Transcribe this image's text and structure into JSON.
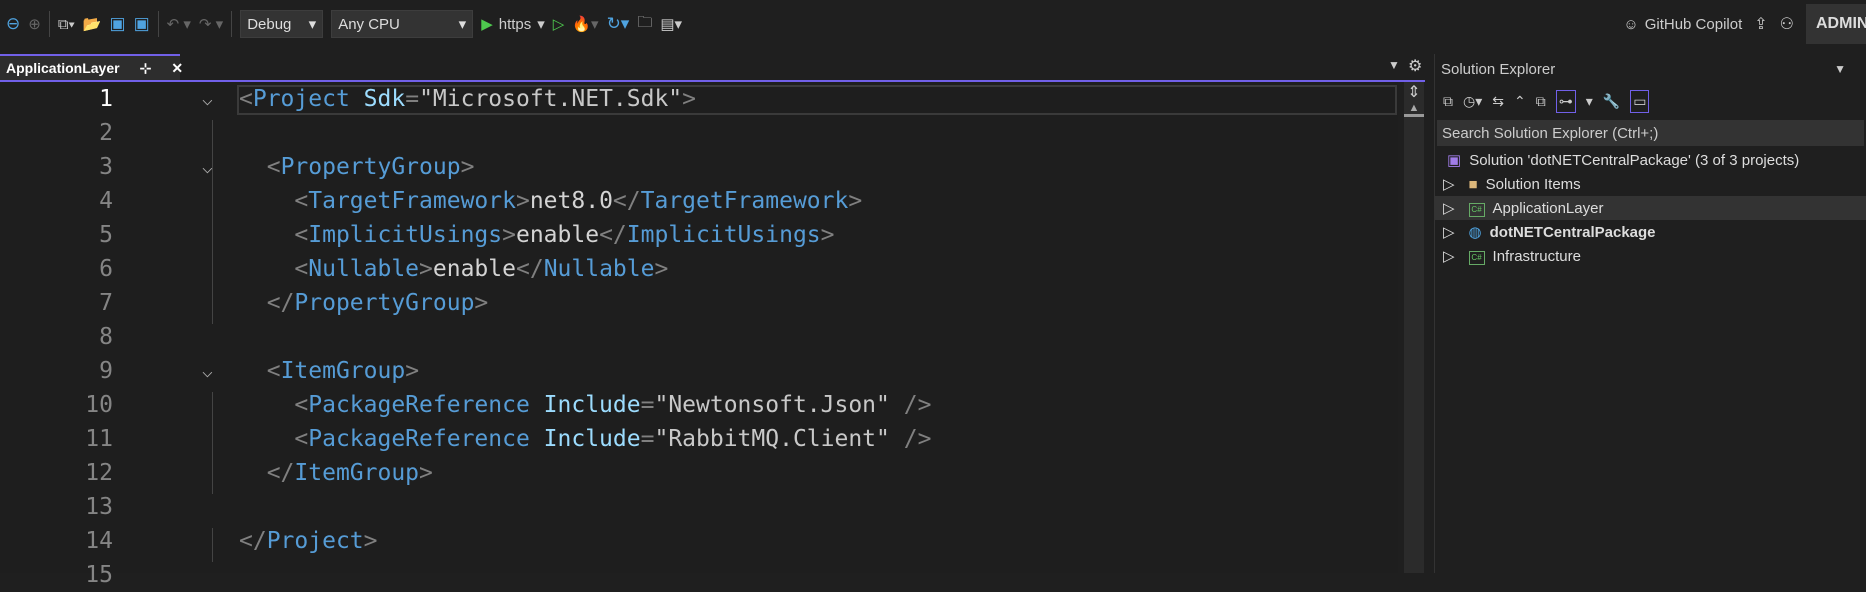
{
  "toolbar": {
    "config": "Debug",
    "platform": "Any CPU",
    "run_target": "https",
    "copilot": "GitHub Copilot",
    "account": "ADMIN"
  },
  "tab": {
    "label": "ApplicationLayer",
    "pin": "⊹",
    "close": "✕"
  },
  "editor": {
    "lines": [
      {
        "n": "1",
        "html": "<span class='b'>&lt;</span><span class='t'>Project</span> <span class='a'>Sdk</span><span class='b'>=</span><span class='v'>\"Microsoft.NET.Sdk\"</span><span class='b'>&gt;</span>",
        "fold": true
      },
      {
        "n": "2",
        "html": ""
      },
      {
        "n": "3",
        "html": "  <span class='b'>&lt;</span><span class='t'>PropertyGroup</span><span class='b'>&gt;</span>",
        "fold": true
      },
      {
        "n": "4",
        "html": "    <span class='b'>&lt;</span><span class='t'>TargetFramework</span><span class='b'>&gt;</span>net8.0<span class='b'>&lt;/</span><span class='t'>TargetFramework</span><span class='b'>&gt;</span>"
      },
      {
        "n": "5",
        "html": "    <span class='b'>&lt;</span><span class='t'>ImplicitUsings</span><span class='b'>&gt;</span>enable<span class='b'>&lt;/</span><span class='t'>ImplicitUsings</span><span class='b'>&gt;</span>"
      },
      {
        "n": "6",
        "html": "    <span class='b'>&lt;</span><span class='t'>Nullable</span><span class='b'>&gt;</span>enable<span class='b'>&lt;/</span><span class='t'>Nullable</span><span class='b'>&gt;</span>"
      },
      {
        "n": "7",
        "html": "  <span class='b'>&lt;/</span><span class='t'>PropertyGroup</span><span class='b'>&gt;</span>"
      },
      {
        "n": "8",
        "html": ""
      },
      {
        "n": "9",
        "html": "  <span class='b'>&lt;</span><span class='t'>ItemGroup</span><span class='b'>&gt;</span>",
        "fold": true
      },
      {
        "n": "10",
        "html": "    <span class='b'>&lt;</span><span class='t'>PackageReference</span> <span class='a'>Include</span><span class='b'>=</span><span class='v'>\"Newtonsoft.Json\"</span> <span class='b'>/&gt;</span>"
      },
      {
        "n": "11",
        "html": "    <span class='b'>&lt;</span><span class='t'>PackageReference</span> <span class='a'>Include</span><span class='b'>=</span><span class='v'>\"RabbitMQ.Client\"</span> <span class='b'>/&gt;</span>"
      },
      {
        "n": "12",
        "html": "  <span class='b'>&lt;/</span><span class='t'>ItemGroup</span><span class='b'>&gt;</span>"
      },
      {
        "n": "13",
        "html": ""
      },
      {
        "n": "14",
        "html": "<span class='b'>&lt;/</span><span class='t'>Project</span><span class='b'>&gt;</span>"
      },
      {
        "n": "15",
        "html": ""
      }
    ]
  },
  "solution_explorer": {
    "title": "Solution Explorer",
    "search_placeholder": "Search Solution Explorer (Ctrl+;)",
    "solution": "Solution 'dotNETCentralPackage' (3 of 3 projects)",
    "items": [
      {
        "label": "Solution Items",
        "icon": "folder-icon"
      },
      {
        "label": "ApplicationLayer",
        "icon": "csharp-project-icon",
        "selected": true
      },
      {
        "label": "dotNETCentralPackage",
        "icon": "web-project-icon",
        "bold": true
      },
      {
        "label": "Infrastructure",
        "icon": "csharp-project-icon"
      }
    ]
  }
}
